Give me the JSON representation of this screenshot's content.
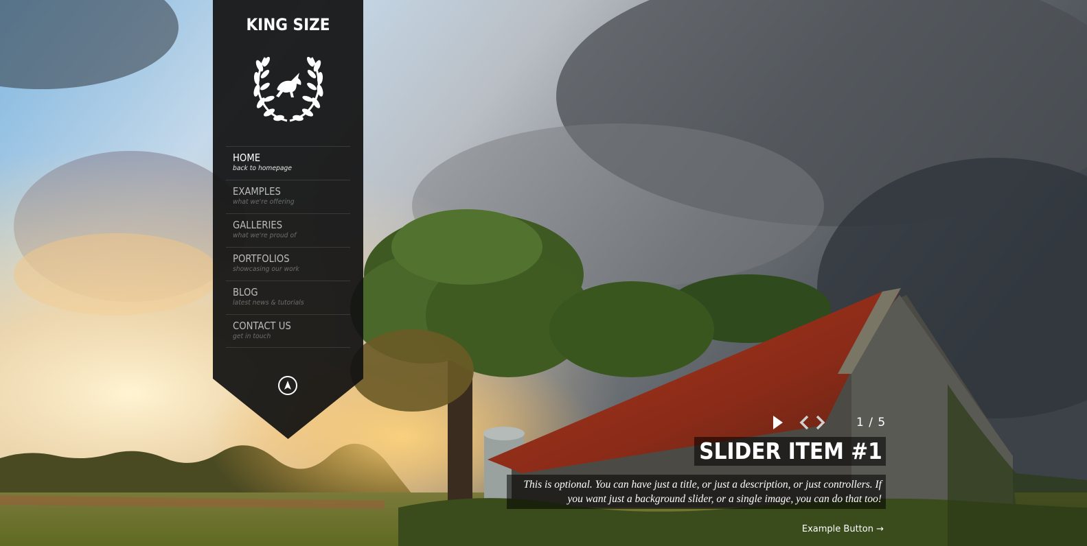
{
  "brand": {
    "title": "KING SIZE"
  },
  "icons": {
    "logo": "laurel-unicorn-icon",
    "scroll_up": "arrow-up-circle-icon",
    "play": "play-icon",
    "prev": "chevron-left-icon",
    "next": "chevron-right-icon"
  },
  "nav": {
    "items": [
      {
        "label": "HOME",
        "sub": "back to homepage"
      },
      {
        "label": "EXAMPLES",
        "sub": "what we're offering"
      },
      {
        "label": "GALLERIES",
        "sub": "what we're proud of"
      },
      {
        "label": "PORTFOLIOS",
        "sub": "showcasing our work"
      },
      {
        "label": "BLOG",
        "sub": "latest news & tutorials"
      },
      {
        "label": "CONTACT US",
        "sub": "get in touch"
      }
    ]
  },
  "slider": {
    "counter": "1 / 5",
    "title": "SLIDER ITEM #1",
    "description": "This is optional. You can have just a title, or just a description, or just controllers. If you want just a background slider, or a single image, you can do that too!",
    "button": "Example Button →"
  },
  "colors": {
    "sidebar": "#121212",
    "text": "#ffffff",
    "nav_text": "#bcbcbc",
    "nav_sub": "#6d6d6d"
  }
}
